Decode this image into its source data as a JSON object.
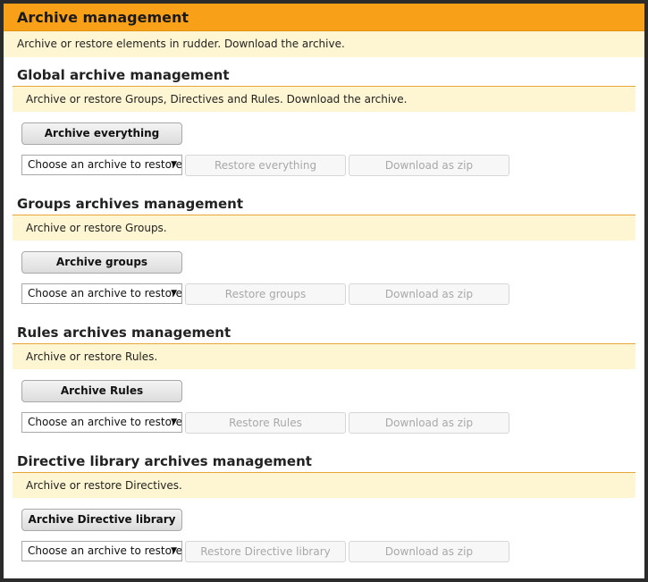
{
  "header": {
    "title": "Archive management",
    "description": "Archive or restore elements in rudder. Download the archive."
  },
  "select_placeholder": "Choose an archive to restore",
  "download_label": "Download as zip",
  "sections": [
    {
      "title": "Global archive management",
      "description": "Archive or restore Groups, Directives and Rules. Download the archive.",
      "archive_label": "Archive everything",
      "restore_label": "Restore everything"
    },
    {
      "title": "Groups archives management",
      "description": "Archive or restore Groups.",
      "archive_label": "Archive groups",
      "restore_label": "Restore groups"
    },
    {
      "title": "Rules archives management",
      "description": "Archive or restore Rules.",
      "archive_label": "Archive Rules",
      "restore_label": "Restore Rules"
    },
    {
      "title": "Directive library archives management",
      "description": "Archive or restore Directives.",
      "archive_label": "Archive Directive library",
      "restore_label": "Restore Directive library"
    }
  ]
}
